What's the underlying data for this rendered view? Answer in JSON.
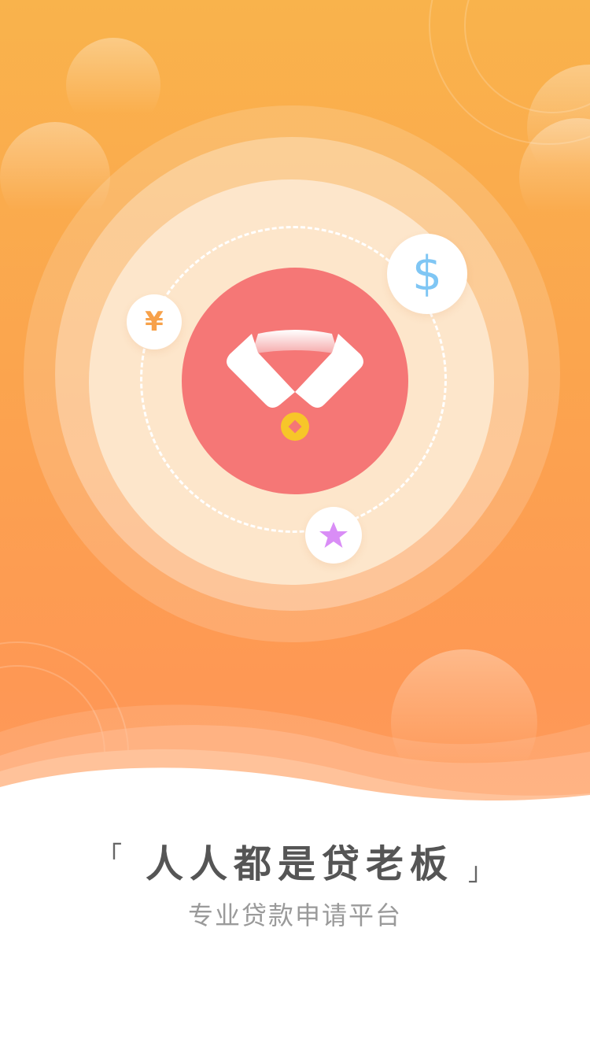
{
  "hero": {
    "colors": {
      "top": "#f9b34c",
      "bottom": "#ff9a5c",
      "center": "#f57776",
      "coin": "#f7c629",
      "yen": "#f7a14a",
      "dollar": "#7fc6f4",
      "star": "#d98df6"
    },
    "icons": {
      "center": "shirt-collar-icon",
      "coin": "coin-icon",
      "left": "yen-icon",
      "right": "dollar-icon",
      "bottom": "star-icon"
    },
    "yen_symbol": "¥",
    "dollar_symbol": "$"
  },
  "slogan": {
    "open_bracket": "「",
    "text": "人人都是贷老板",
    "close_bracket": "」"
  },
  "subtitle": "专业贷款申请平台"
}
